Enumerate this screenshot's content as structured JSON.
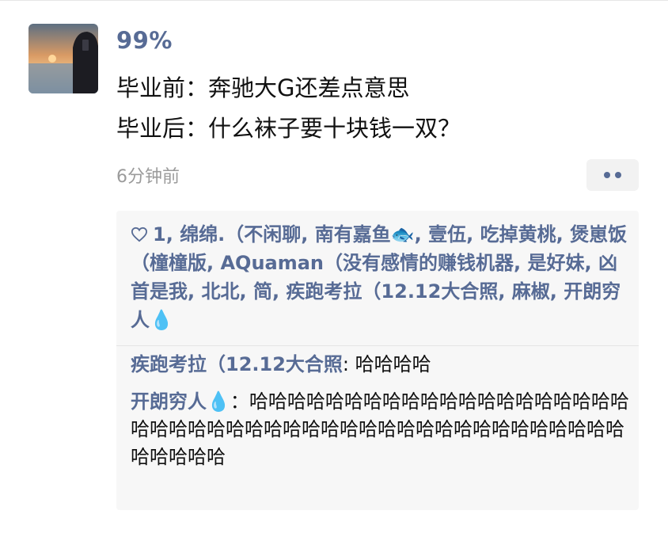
{
  "post": {
    "username": "99%",
    "lines": [
      "毕业前：奔驰大G还差点意思",
      "毕业后：什么袜子要十块钱一双？"
    ],
    "timestamp": "6分钟前"
  },
  "likes": {
    "count": "1",
    "names": "绵绵.（不闲聊, 南有嘉鱼🐟, 壹伍, 吃掉黄桃, 煲崽饭（橦橦版, AQuaman（没有感情的赚钱机器, 是好妹, 凶首是我, 北北, 简, 疾跑考拉（12.12大合照, 麻椒, 开朗穷人💧"
  },
  "comments": [
    {
      "name": "疾跑考拉（12.12大合照",
      "sep": ": ",
      "text": "哈哈哈哈"
    },
    {
      "name": "开朗穷人💧",
      "sep": "：",
      "text": "哈哈哈哈哈哈哈哈哈哈哈哈哈哈哈哈哈哈哈哈哈哈哈哈哈哈哈哈哈哈哈哈哈哈哈哈哈哈哈哈哈哈哈哈哈哈哈哈哈哈哈"
    }
  ],
  "colors": {
    "link": "#576b95",
    "panel": "#f7f7f7",
    "meta": "#9b9b9b"
  },
  "icons": {
    "like": "heart-outline-icon",
    "more": "more-dots-icon"
  }
}
